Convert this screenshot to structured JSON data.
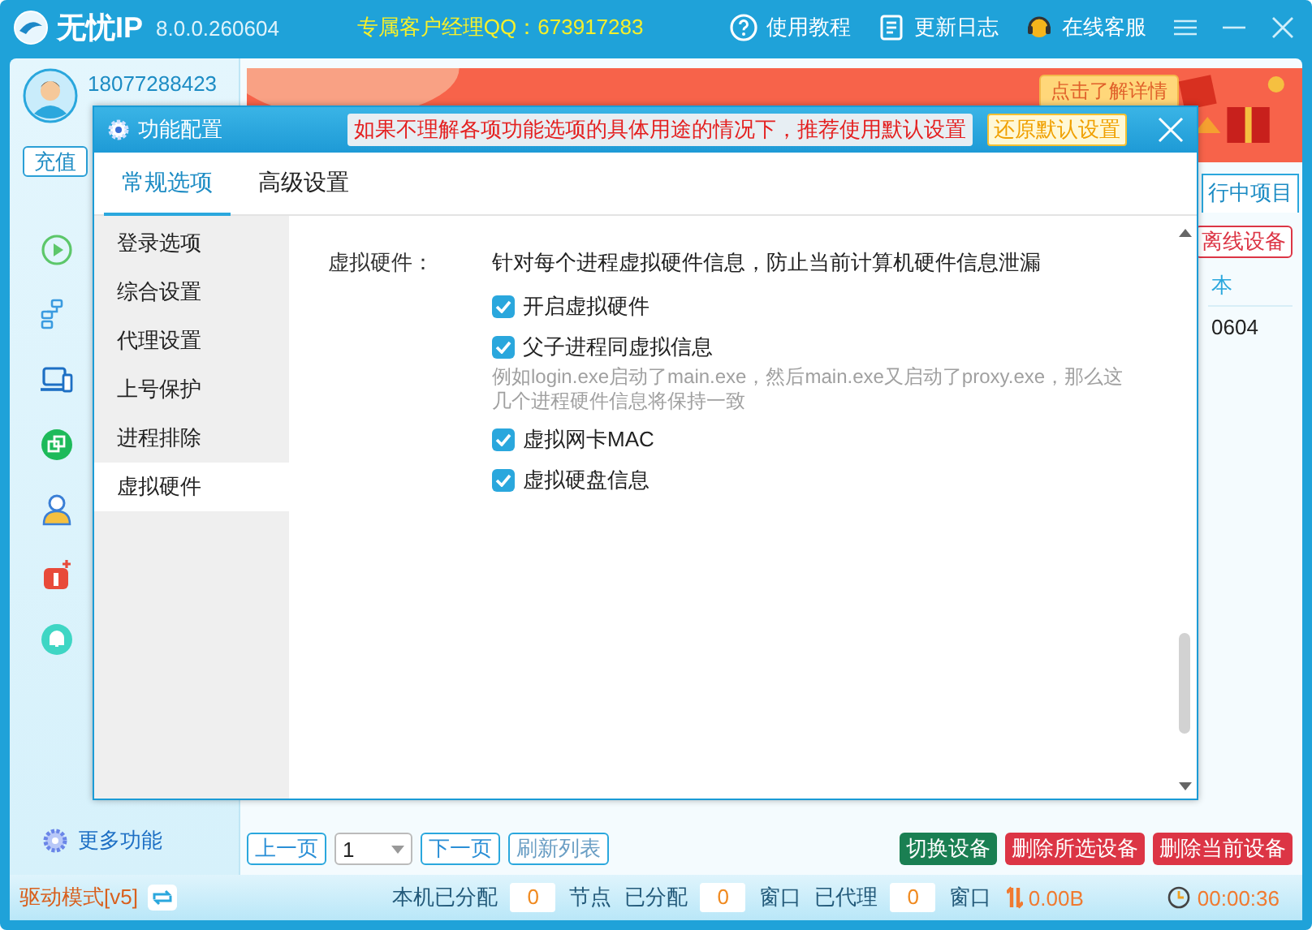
{
  "app": {
    "logo_text": "无忧IP",
    "version": "8.0.0.260604",
    "manager": "专属客户经理QQ：673917283",
    "header_links": [
      "使用教程",
      "更新日志",
      "在线客服"
    ]
  },
  "account": {
    "phone": "18077288423",
    "recharge_button": "充值",
    "more_features": "更多功能"
  },
  "banner": {
    "kind": "picture",
    "cta": "点击了解详情"
  },
  "device_panel": {
    "tab": "行中项目",
    "offline_button": "离线设备",
    "table": {
      "columns": [
        "本"
      ],
      "rows": [
        [
          "0604"
        ]
      ]
    }
  },
  "pagination": {
    "prev": "上一页",
    "page": "1",
    "next": "下一页",
    "refresh": "刷新列表"
  },
  "actions": [
    {
      "label": "切换设备",
      "color": "#1a7f52"
    },
    {
      "label": "删除所选设备",
      "color": "#dc3545"
    },
    {
      "label": "删除当前设备",
      "color": "#dc3545"
    }
  ],
  "status_bar": {
    "driver_mode": "驱动模式[v5]",
    "stats": [
      {
        "label": "本机已分配",
        "value": "0",
        "unit": "节点"
      },
      {
        "label": "已分配",
        "value": "0",
        "unit": "窗口"
      },
      {
        "label": "已代理",
        "value": "0",
        "unit": "窗口"
      }
    ],
    "traffic": "0.00B",
    "timer": "00:00:36"
  },
  "dialog": {
    "title": "功能配置",
    "notice": "如果不理解各项功能选项的具体用途的情况下，推荐使用默认设置",
    "reset_button": "还原默认设置",
    "tabs": [
      {
        "label": "常规选项",
        "selected": true
      },
      {
        "label": "高级设置",
        "selected": false
      }
    ],
    "sidebar": [
      {
        "label": "登录选项",
        "selected": false
      },
      {
        "label": "综合设置",
        "selected": false
      },
      {
        "label": "代理设置",
        "selected": false
      },
      {
        "label": "上号保护",
        "selected": false
      },
      {
        "label": "进程排除",
        "selected": false
      },
      {
        "label": "虚拟硬件",
        "selected": true
      }
    ],
    "section": {
      "label": "虚拟硬件：",
      "description": "针对每个进程虚拟硬件信息，防止当前计算机硬件信息泄漏",
      "options": [
        {
          "kind": "checkbox",
          "label": "开启虚拟硬件",
          "checked": true
        },
        {
          "kind": "checkbox",
          "label": "父子进程同虚拟信息",
          "checked": true
        },
        {
          "kind": "hint",
          "text": "例如login.exe启动了main.exe，然后main.exe又启动了proxy.exe，那么这几个进程硬件信息将保持一致"
        },
        {
          "kind": "checkbox",
          "label": "虚拟网卡MAC",
          "checked": true
        },
        {
          "kind": "checkbox",
          "label": "虚拟硬盘信息",
          "checked": true
        }
      ]
    }
  }
}
